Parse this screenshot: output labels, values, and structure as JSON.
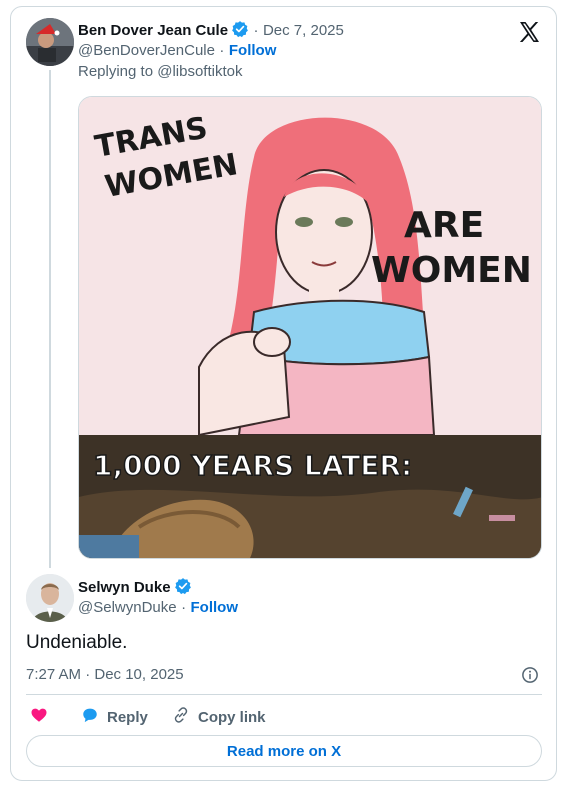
{
  "parent_tweet": {
    "author_name": "Ben Dover Jean Cule",
    "date": "Dec 7, 2025",
    "handle": "@BenDoverJenCule",
    "follow_label": "Follow",
    "replying_to": "Replying to @libsoftiktok",
    "media": {
      "top_text_1": "TRANS",
      "top_text_2": "WOMEN",
      "top_text_3": "ARE",
      "top_text_4": "WOMEN",
      "bottom_caption": "1,000 YEARS LATER:"
    }
  },
  "reply_tweet": {
    "author_name": "Selwyn Duke",
    "handle": "@SelwynDuke",
    "follow_label": "Follow",
    "text": "Undeniable.",
    "timestamp": "7:27 AM · Dec 10, 2025"
  },
  "actions": {
    "reply_label": "Reply",
    "copy_link_label": "Copy link",
    "read_more_label": "Read more on X"
  },
  "colors": {
    "link_blue": "#006fd6",
    "verified_blue": "#1d9bf0",
    "heart_pink": "#f91880",
    "border": "#cfd9de"
  }
}
